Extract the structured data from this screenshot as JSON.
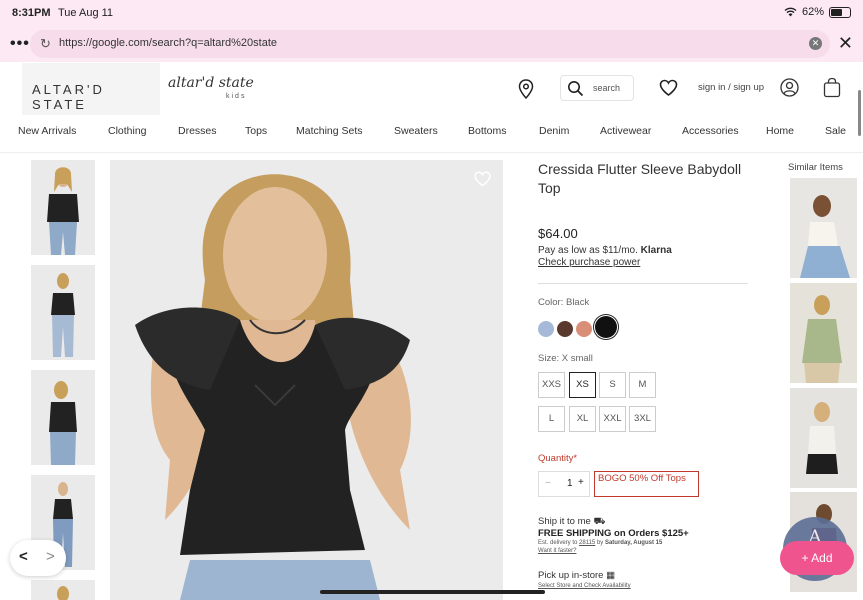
{
  "status_bar": {
    "time": "8:31PM",
    "day": "Tue Aug 11",
    "battery": "62%",
    "battery_level": 0.62
  },
  "browser": {
    "url": "https://google.com/search?q=altard%20state",
    "menu_icon": "more-dots-icon",
    "close_icon": "close-icon"
  },
  "header": {
    "logo": "ALTAR'D STATE",
    "kids_logo": "altar'd state",
    "kids_sub": "kids",
    "search_placeholder": "search",
    "sign_in": "sign in / sign up"
  },
  "nav": [
    "New Arrivals",
    "Clothing",
    "Dresses",
    "Tops",
    "Matching Sets",
    "Sweaters",
    "Bottoms",
    "Denim",
    "Activewear",
    "Accessories",
    "Home",
    "Sale"
  ],
  "product": {
    "title": "Cressida Flutter Sleeve Babydoll Top",
    "price": "$64.00",
    "pay_prefix": "Pay as low as $11/mo.",
    "pay_brand": "Klarna",
    "check_link": "Check purchase power",
    "color_label": "Color: Black",
    "swatches": [
      {
        "name": "light-blue",
        "color": "#a7b9d8"
      },
      {
        "name": "brown",
        "color": "#5b3a2e"
      },
      {
        "name": "salmon",
        "color": "#d98e78"
      },
      {
        "name": "black",
        "color": "#111111",
        "selected": true
      }
    ],
    "size_label": "Size: X small",
    "sizes_row1": [
      "XXS",
      "XS",
      "S",
      "M"
    ],
    "sizes_row2": [
      "L",
      "XL",
      "XXL",
      "3XL"
    ],
    "selected_size": "XS",
    "quantity_label": "Quantity*",
    "quantity": "1",
    "minus": "−",
    "plus": "+",
    "promo": "BOGO 50% Off Tops",
    "ship_title": "Ship it to me",
    "ship_free": "FREE SHIPPING on Orders $125+",
    "ship_est_prefix": "Est. delivery to",
    "ship_zip": "28115",
    "ship_by": "by",
    "ship_date": "Saturday, August 15",
    "ship_faster": "Want it faster?",
    "pickup_title": "Pick up in-store",
    "pickup_link": "Select Store and Check Availability"
  },
  "similar_label": "Similar Items",
  "add_button": "Add",
  "chat_letter": "A"
}
